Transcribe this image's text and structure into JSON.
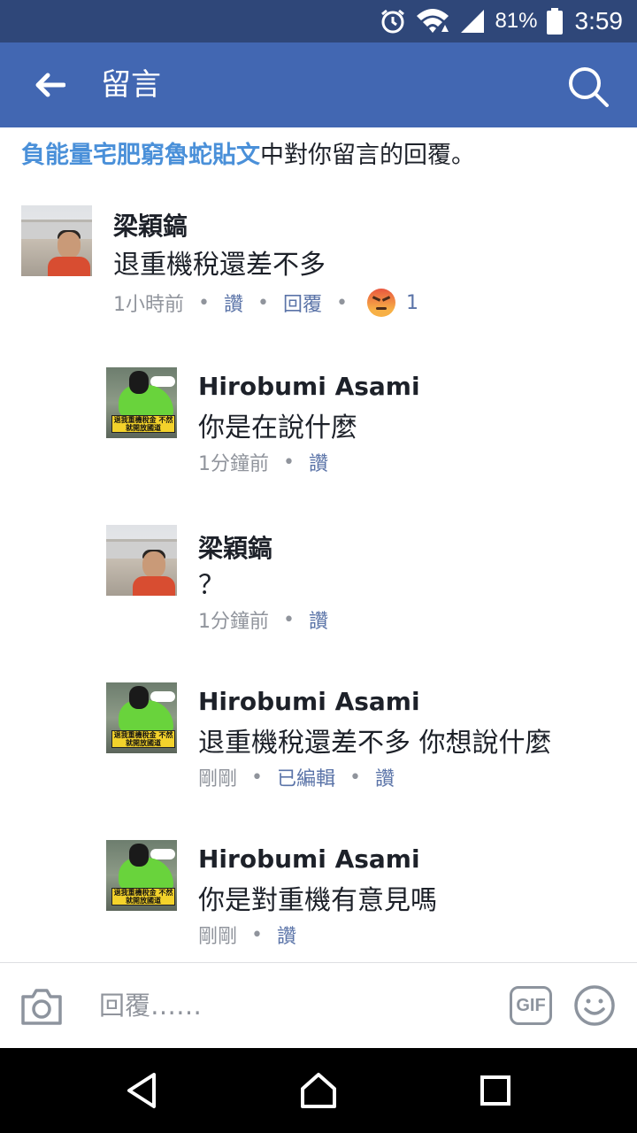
{
  "status_bar": {
    "battery_percent": "81%",
    "time": "3:59",
    "icons": [
      "alarm-icon",
      "wifi-icon",
      "signal-icon",
      "battery-icon"
    ]
  },
  "app_bar": {
    "title": "留言",
    "back_icon": "back-arrow-icon",
    "search_icon": "search-icon"
  },
  "context": {
    "link_text": "負能量宅肥窮魯蛇貼文",
    "suffix_text": "中對你留言的回覆。"
  },
  "comments": [
    {
      "author": "梁穎鎬",
      "text": "退重機稅還差不多",
      "time": "1小時前",
      "actions": [
        "讚",
        "回覆"
      ],
      "reaction": {
        "icon": "angry-reaction-icon",
        "count": "1"
      }
    },
    {
      "author": "Hirobumi Asami",
      "text": "你是在說什麼",
      "time": "1分鐘前",
      "actions": [
        "讚"
      ]
    },
    {
      "author": "梁穎鎬",
      "text": "？",
      "time": "1分鐘前",
      "actions": [
        "讚"
      ]
    },
    {
      "author": "Hirobumi Asami",
      "text": "退重機稅還差不多 你想說什麼",
      "time": "剛剛",
      "edited": "已編輯",
      "actions": [
        "讚"
      ]
    },
    {
      "author": "Hirobumi Asami",
      "text": "你是對重機有意見嗎",
      "time": "剛剛",
      "actions": [
        "讚"
      ]
    }
  ],
  "avatar_banner_text": "退我重機稅金 不然就開放國道",
  "composer": {
    "placeholder": "回覆……",
    "gif_label": "GIF",
    "camera_icon": "camera-icon",
    "emoji_icon": "emoji-icon"
  },
  "nav_bar": {
    "icons": [
      "back-triangle-icon",
      "home-icon",
      "recents-square-icon"
    ]
  },
  "colors": {
    "status_bar": "#2f4779",
    "app_bar": "#4267b2",
    "link": "#4a90d9",
    "action": "#5b74a8",
    "meta": "#90949c"
  }
}
